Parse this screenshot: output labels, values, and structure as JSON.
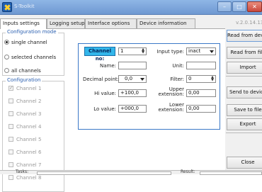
{
  "window": {
    "title": "S-Toolkit",
    "min_symbol": "–",
    "max_symbol": "□",
    "close_symbol": "✕"
  },
  "tabs": [
    "Inputs settings",
    "Logging setup",
    "Interface options",
    "Device information"
  ],
  "version": "v.2.0.14.13",
  "config_mode": {
    "title": "Configuration mode",
    "options": [
      {
        "label": "single channel",
        "selected": true
      },
      {
        "label": "selected channels",
        "selected": false
      },
      {
        "label": "all channels",
        "selected": false
      }
    ]
  },
  "configuration": {
    "title": "Configuration",
    "channels": [
      {
        "label": "Channel 1",
        "checked": true
      },
      {
        "label": "Channel 2",
        "checked": false
      },
      {
        "label": "Channel 3",
        "checked": false
      },
      {
        "label": "Channel 4",
        "checked": false
      },
      {
        "label": "Channel 5",
        "checked": false
      },
      {
        "label": "Channel 6",
        "checked": false
      },
      {
        "label": "Channel 7",
        "checked": false
      },
      {
        "label": "Channel 8",
        "checked": false
      }
    ]
  },
  "channel": {
    "channel_no_label": "Channel no:",
    "channel_no_value": "1",
    "input_type_label": "Input type:",
    "input_type_value": "inact",
    "name_label": "Name:",
    "name_value": "",
    "unit_label": "Unit:",
    "unit_value": "",
    "decimal_point_label": "Decimal point:",
    "decimal_point_value": "0,0",
    "filter_label": "Filter:",
    "filter_value": "0",
    "hi_value_label": "Hi value:",
    "hi_value": "+100,0",
    "upper_ext_label": "Upper extension:",
    "upper_ext_value": "0,00",
    "lo_value_label": "Lo value:",
    "lo_value": "+000,0",
    "lower_ext_label": "Lower extension:",
    "lower_ext_value": "0,00"
  },
  "right_buttons": {
    "read_device": "Read from device",
    "read_file": "Read from file",
    "import": "Import",
    "send_device": "Send to device",
    "save_file": "Save to file",
    "export": "Export",
    "close": "Close"
  },
  "status": {
    "left_label": "Tasks:",
    "right_label": "Result:"
  }
}
